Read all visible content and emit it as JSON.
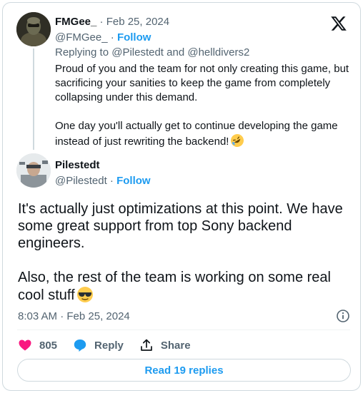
{
  "parent_tweet": {
    "name": "FMGee_",
    "date": "Feb 25, 2024",
    "handle": "@FMGee_",
    "follow_label": "Follow",
    "replying_prefix": "Replying to",
    "reply_to_1": "@Pilestedt",
    "reply_conj": "and",
    "reply_to_2": "@helldivers2",
    "text_1": "Proud of you and the team for not only creating this game, but sacrificing your sanities to keep the game from completely collapsing under this demand.",
    "text_2": "One day you'll actually get to continue developing the game instead of just rewriting the backend!",
    "emoji": "rolling-on-floor-laughing-emoji"
  },
  "main_tweet": {
    "name": "Pilestedt",
    "handle": "@Pilestedt",
    "follow_label": "Follow",
    "text_1": "It's actually just optimizations at this point. We have some great support from top Sony backend engineers.",
    "text_2": "Also, the rest of the team is working on some real cool stuff",
    "emoji": "sunglasses-emoji",
    "timestamp": "8:03 AM · Feb 25, 2024"
  },
  "actions": {
    "like_count": "805",
    "reply_label": "Reply",
    "share_label": "Share"
  },
  "read_replies_label": "Read 19 replies",
  "colors": {
    "accent": "#1d9bf0",
    "like": "#f91880",
    "muted": "#536471",
    "border": "#cfd9de"
  }
}
